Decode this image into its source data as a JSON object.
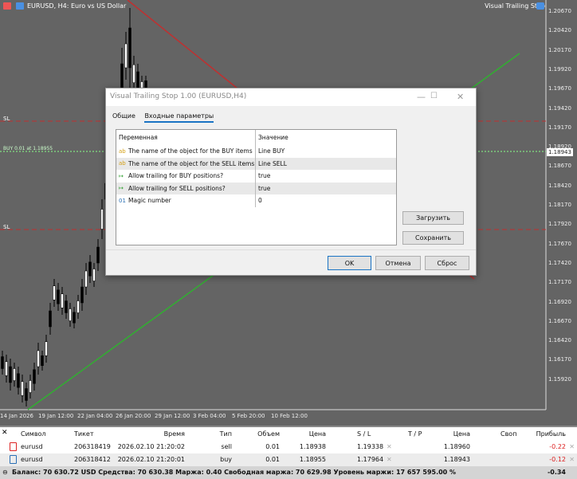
{
  "chart": {
    "title": "EURUSD, H4:  Euro vs US Dollar",
    "indicator": "Visual Trailing Stop",
    "sl_label": "SL",
    "buy_label": "BUY 0.01 at 1.18955",
    "current_price": "1.18943",
    "price_ticks": [
      "1.20670",
      "1.20420",
      "1.20170",
      "1.19920",
      "1.19670",
      "1.19420",
      "1.19170",
      "1.18920",
      "1.18670",
      "1.18420",
      "1.18170",
      "1.17920",
      "1.17670",
      "1.17420",
      "1.17170",
      "1.16920",
      "1.16670",
      "1.16420",
      "1.16170",
      "1.15920"
    ],
    "time_ticks": [
      "14 Jan 2026",
      "19 Jan 12:00",
      "22 Jan 04:00",
      "26 Jan 20:00",
      "29 Jan 12:00",
      "3 Feb 04:00",
      "5 Feb 20:00",
      "10 Feb 12:00"
    ],
    "colors": {
      "bg": "#646464",
      "sell_line": "#c03030",
      "buy_line": "#30b030"
    }
  },
  "dialog": {
    "title": "Visual Trailing Stop 1.00 (EURUSD,H4)",
    "tabs": [
      "Общие",
      "Входные параметры"
    ],
    "columns": [
      "Переменная",
      "Значение"
    ],
    "params": [
      {
        "icon": "ab",
        "name": "The name of the object for the BUY items",
        "value": "Line BUY"
      },
      {
        "icon": "ab",
        "name": "The name of the object for the SELL items",
        "value": "Line SELL"
      },
      {
        "icon": "bool",
        "name": "Allow trailing for BUY positions?",
        "value": "true"
      },
      {
        "icon": "bool",
        "name": "Allow trailing for SELL positions?",
        "value": "true"
      },
      {
        "icon": "01",
        "name": "Magic number",
        "value": "0"
      }
    ],
    "load": "Загрузить",
    "save": "Сохранить",
    "ok": "OK",
    "cancel": "Отмена",
    "reset": "Сброс",
    "icon_ab": "ab",
    "icon_01": "01"
  },
  "trade": {
    "headers": [
      "Символ",
      "Тикет",
      "Время",
      "Тип",
      "Объем",
      "Цена",
      "S / L",
      "T / P",
      "Цена",
      "Своп",
      "Прибыль"
    ],
    "rows": [
      {
        "symbol": "eurusd",
        "ticket": "206318419",
        "time": "2026.02.10 21:20:02",
        "type": "sell",
        "volume": "0.01",
        "price": "1.18938",
        "sl": "1.19338",
        "tp": "",
        "cur": "1.18960",
        "swap": "",
        "profit": "-0.22"
      },
      {
        "symbol": "eurusd",
        "ticket": "206318412",
        "time": "2026.02.10 21:20:01",
        "type": "buy",
        "volume": "0.01",
        "price": "1.18955",
        "sl": "1.17964",
        "tp": "",
        "cur": "1.18943",
        "swap": "",
        "profit": "-0.12"
      }
    ],
    "summary": "Баланс: 70 630.72 USD  Средства: 70 630.38  Маржа: 0.40  Свободная маржа: 70 629.98  Уровень маржи: 17 657 595.00 %",
    "total": "-0.34"
  }
}
